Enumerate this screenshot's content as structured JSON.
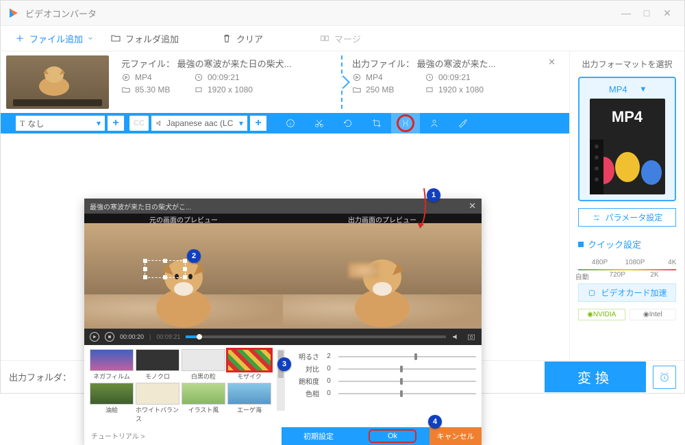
{
  "window": {
    "title": "ビデオコンバータ"
  },
  "toolbar": {
    "add_file": "ファイル追加",
    "add_folder": "フォルダ追加",
    "clear": "クリア",
    "merge": "マージ"
  },
  "source": {
    "title": "元ファイル： 最強の寒波が来た日の柴犬...",
    "format": "MP4",
    "duration": "00:09:21",
    "size": "85.30 MB",
    "resolution": "1920 x 1080"
  },
  "output": {
    "title": "出力ファイル： 最強の寒波が来た...",
    "format": "MP4",
    "duration": "00:09:21",
    "size": "250 MB",
    "resolution": "1920 x 1080"
  },
  "edit_toolbar": {
    "subtitle_none": "なし",
    "audio_track": "Japanese aac (LC"
  },
  "right_panel": {
    "title": "出力フォーマットを選択",
    "format": "MP4",
    "param_btn": "パラメータ設定",
    "quick_title": "クイック設定",
    "q480": "480P",
    "q720": "720P",
    "q1080": "1080P",
    "q2k": "2K",
    "q4k": "4K",
    "auto": "自動",
    "gpu_btn": "ビデオカード加速",
    "nvidia": "NVIDIA",
    "intel": "Intel"
  },
  "bottom": {
    "out_folder": "出力フォルダ：",
    "convert": "変換"
  },
  "dialog": {
    "title": "最強の寒波が来た日の柴犬がこ...",
    "left_preview": "元の画面のプレビュー",
    "right_preview": "出力画面のプレビュー",
    "time_cur": "00:00:20",
    "time_total": "00:09:21",
    "effects": {
      "nega": "ネガフィルム",
      "mono": "モノクロ",
      "white": "白黒の粒",
      "mosaic": "モザイク",
      "oil": "油絵",
      "wb": "ホワイトバランス",
      "illust": "イラスト風",
      "aegean": "エーゲ海"
    },
    "sliders": {
      "brightness": "明るさ",
      "brightness_v": "2",
      "contrast": "対比",
      "contrast_v": "0",
      "saturation": "飽和度",
      "saturation_v": "0",
      "hue": "色相",
      "hue_v": "0"
    },
    "tutorial": "チュートリアル >",
    "reset": "初期設定",
    "ok": "Ok",
    "cancel": "キャンセル"
  }
}
